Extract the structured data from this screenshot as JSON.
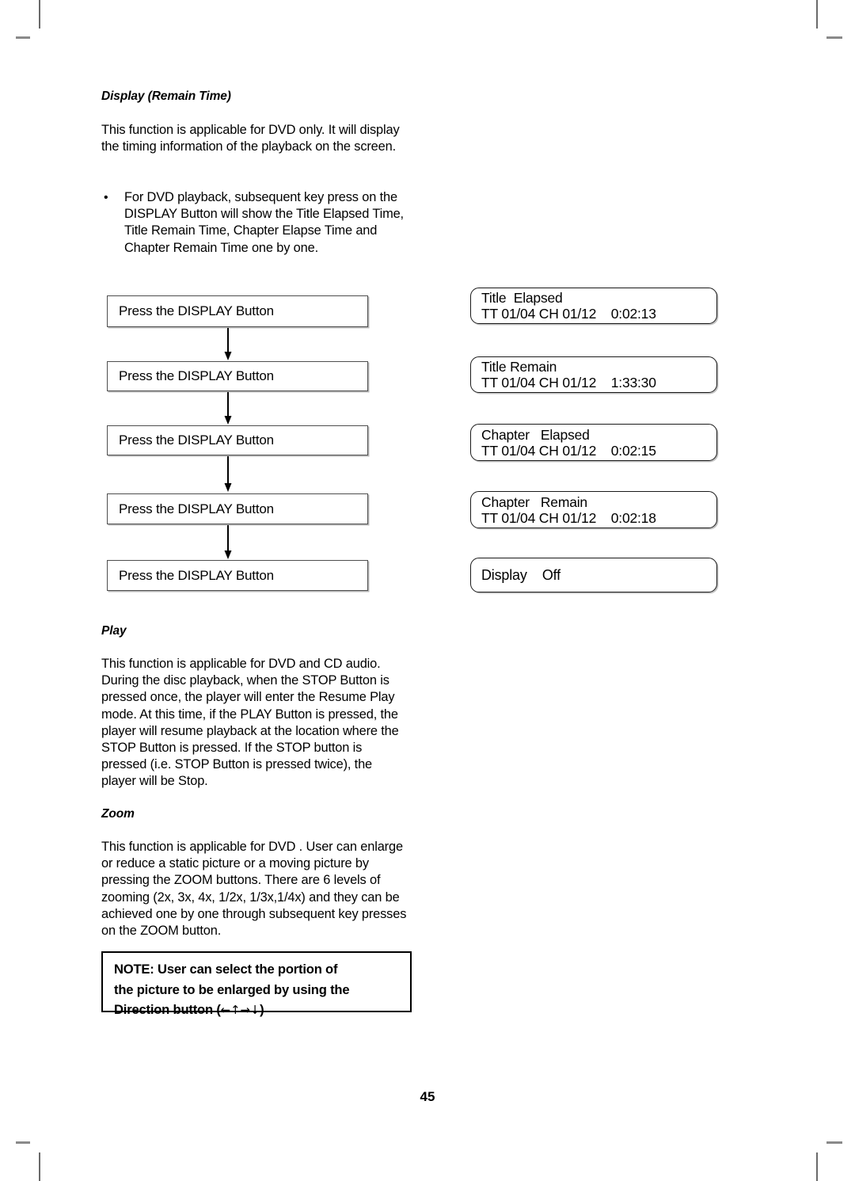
{
  "page": {
    "number": "45"
  },
  "sections": {
    "display_remain_time": {
      "heading": "Display (Remain Time)",
      "intro": "This function is applicable for DVD only. It will display the timing information of the playback on the screen.",
      "bullet": {
        "marker": "bullet-dot",
        "text": "For DVD playback, subsequent key press on the DISPLAY Button will show the Title Elapsed Time, Title Remain Time, Chapter Elapse Time and Chapter Remain Time one by one."
      }
    },
    "play": {
      "heading": "Play",
      "body": "This function is applicable for DVD and CD audio. During the disc playback, when the STOP Button is pressed once, the player will enter the Resume Play mode. At this time, if the PLAY Button is pressed, the player will resume playback at the location where the STOP Button is pressed. If the STOP button is pressed (i.e. STOP Button is pressed twice), the player will be Stop."
    },
    "zoom": {
      "heading": "Zoom",
      "body": "This function is applicable for DVD . User can enlarge or reduce a static picture or a moving picture by pressing the ZOOM buttons. There are 6 levels of zooming (2x, 3x, 4x, 1/2x, 1/3x,1/4x) and they can be achieved one by one through subsequent key presses on the ZOOM button."
    }
  },
  "flowchart": {
    "steps": [
      {
        "label": "Press the DISPLAY Button"
      },
      {
        "label": "Press the DISPLAY Button"
      },
      {
        "label": "Press the DISPLAY Button"
      },
      {
        "label": "Press the DISPLAY Button"
      },
      {
        "label": "Press the DISPLAY Button"
      }
    ],
    "arrow_icon": "arrow-down-icon"
  },
  "display_panels": [
    {
      "mode": "Title  Elapsed",
      "info": "TT 01/04 CH 01/12    0:02:13"
    },
    {
      "mode": "Title Remain",
      "info": "TT 01/04 CH 01/12    1:33:30"
    },
    {
      "mode": "Chapter   Elapsed",
      "info": "TT 01/04 CH 01/12    0:02:15"
    },
    {
      "mode": "Chapter   Remain",
      "info": "TT 01/04 CH 01/12    0:02:18"
    },
    {
      "mode": "Display    Off",
      "info": ""
    }
  ],
  "note": {
    "line1": "NOTE: User can select the portion of",
    "line2": "the picture to be enlarged by using the",
    "line3_prefix": "Direction button (",
    "arrows": "←↑→↓",
    "line3_suffix": ")"
  }
}
